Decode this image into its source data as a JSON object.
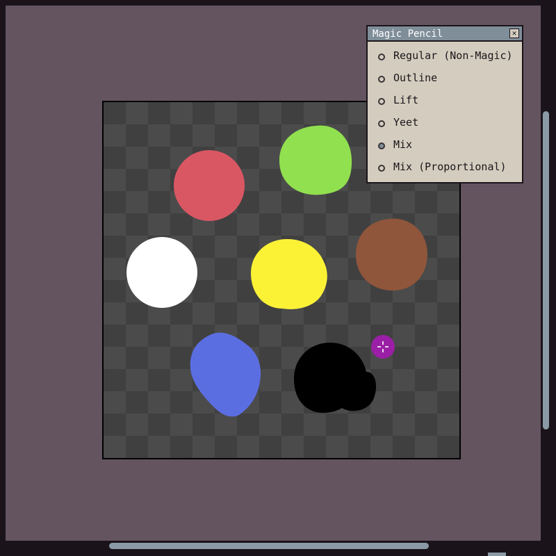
{
  "panel": {
    "title": "Magic Pencil",
    "close_icon": "close-x-icon",
    "options": [
      {
        "label": "Regular (Non-Magic)",
        "selected": false
      },
      {
        "label": "Outline",
        "selected": false
      },
      {
        "label": "Lift",
        "selected": false
      },
      {
        "label": "Yeet",
        "selected": false
      },
      {
        "label": "Mix",
        "selected": true
      },
      {
        "label": "Mix (Proportional)",
        "selected": false
      }
    ]
  },
  "canvas": {
    "blobs": [
      {
        "name": "red-blob",
        "color": "#d95763"
      },
      {
        "name": "green-blob",
        "color": "#91e04f"
      },
      {
        "name": "white-blob",
        "color": "#ffffff"
      },
      {
        "name": "yellow-blob",
        "color": "#fbf236"
      },
      {
        "name": "brown-blob",
        "color": "#8f563b"
      },
      {
        "name": "blue-blob",
        "color": "#5b6ee1"
      },
      {
        "name": "black-blob",
        "color": "#000000"
      }
    ]
  },
  "cursor": {
    "color": "#9b1fa6",
    "icon": "crosshair-brush-cursor-icon"
  }
}
